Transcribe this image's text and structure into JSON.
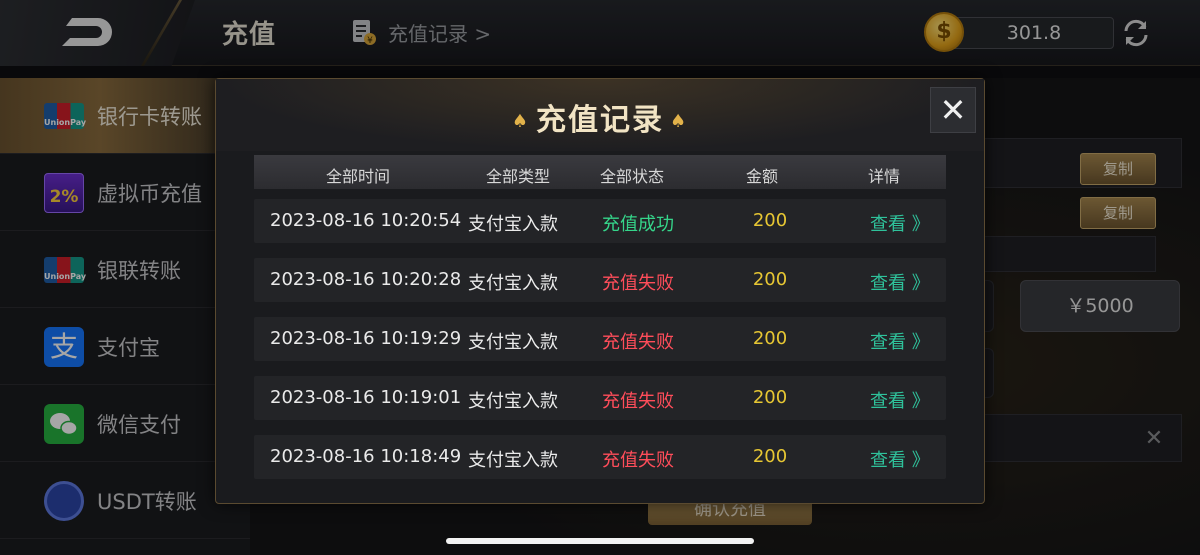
{
  "header": {
    "title": "充值",
    "record_link": "充值记录 >",
    "balance": "301.8",
    "coin_symbol": "$"
  },
  "sidebar": {
    "items": [
      {
        "label": "银行卡转账",
        "icon": "unionpay-icon",
        "active": true
      },
      {
        "label": "虚拟币充值",
        "icon": "vippay-icon",
        "badge": "2%"
      },
      {
        "label": "银联转账",
        "icon": "unionpay-icon"
      },
      {
        "label": "支付宝",
        "icon": "alipay-icon"
      },
      {
        "label": "微信支付",
        "icon": "wechat-icon"
      },
      {
        "label": "USDT转账",
        "icon": "usdt-icon"
      }
    ]
  },
  "background": {
    "copy_label_1": "复制",
    "copy_label_2": "复制",
    "amount_option": "￥5000",
    "confirm_label": "确认充值"
  },
  "modal": {
    "title": "充值记录",
    "columns": [
      "全部时间",
      "全部类型",
      "全部状态",
      "金额",
      "详情"
    ],
    "rows": [
      {
        "time": "2023-08-16 10:20:54",
        "type": "支付宝入款",
        "status": "充值成功",
        "status_kind": "ok",
        "amount": "200",
        "detail": "查看 》"
      },
      {
        "time": "2023-08-16 10:20:28",
        "type": "支付宝入款",
        "status": "充值失败",
        "status_kind": "fail",
        "amount": "200",
        "detail": "查看 》"
      },
      {
        "time": "2023-08-16 10:19:29",
        "type": "支付宝入款",
        "status": "充值失败",
        "status_kind": "fail",
        "amount": "200",
        "detail": "查看 》"
      },
      {
        "time": "2023-08-16 10:19:01",
        "type": "支付宝入款",
        "status": "充值失败",
        "status_kind": "fail",
        "amount": "200",
        "detail": "查看 》"
      },
      {
        "time": "2023-08-16 10:18:49",
        "type": "支付宝入款",
        "status": "充值失败",
        "status_kind": "fail",
        "amount": "200",
        "detail": "查看 》"
      }
    ]
  },
  "colors": {
    "success": "#35d58a",
    "fail": "#ff4d5a",
    "amount": "#e7c733",
    "detail": "#2fc29b",
    "accent_gold": "#b6955a"
  }
}
